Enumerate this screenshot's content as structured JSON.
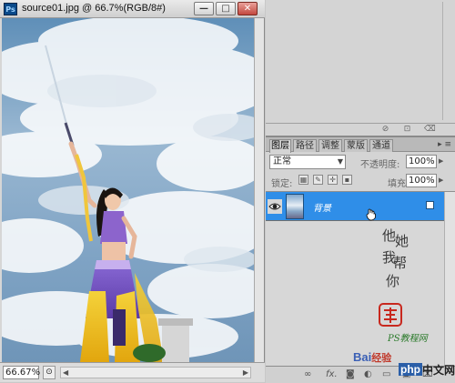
{
  "document": {
    "title": "source01.jpg @ 66.7%(RGB/8#)",
    "app_badge": "Ps",
    "zoom": "66.67%",
    "status_button": "⊙"
  },
  "window_controls": {
    "minimize": "—",
    "maximize": "□",
    "close": "✕"
  },
  "layers_panel": {
    "tabs": [
      "图层",
      "路径",
      "调整",
      "蒙版",
      "通道"
    ],
    "active_tab": "图层",
    "panel_menu": "▸ ≡",
    "blend_mode": "正常",
    "opacity_label": "不透明度:",
    "opacity_value": "100%",
    "lock_label": "锁定:",
    "fill_label": "填充:",
    "fill_value": "100%",
    "layers": [
      {
        "name": "背景",
        "visible": true,
        "locked": true,
        "selected": true
      }
    ],
    "bottom_icons": [
      "link-icon",
      "fx-icon",
      "mask-icon",
      "adjustment-icon",
      "group-icon",
      "new-layer-icon",
      "trash-icon"
    ],
    "bottom_labels": {
      "fx": "fx."
    }
  },
  "watermark": {
    "handwriting": [
      "他",
      "她",
      "我",
      "帮",
      "你"
    ],
    "site_text": "PS教程网",
    "baidu_text": "Bai",
    "baidu_suffix": "经验",
    "php_text": "php",
    "php_cn": "中文网"
  },
  "colors": {
    "selection_blue": "#2f8ee8",
    "panel_gray": "#d4d4d4",
    "stamp_red": "#c8281e"
  }
}
